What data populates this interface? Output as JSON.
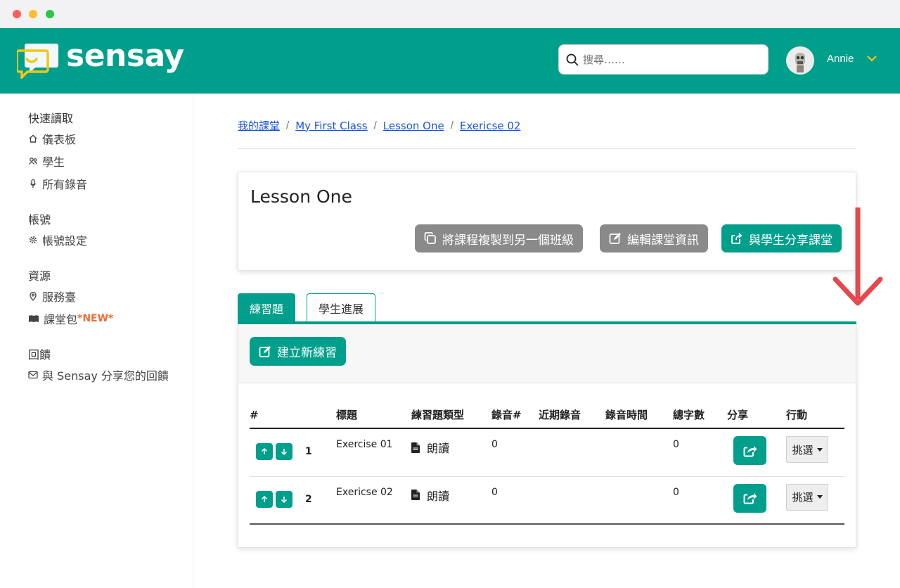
{
  "brand": {
    "name": "sensay"
  },
  "search": {
    "placeholder": "搜尋……"
  },
  "user": {
    "name": "Annie"
  },
  "sidebar": {
    "groups": [
      {
        "heading": "快速讀取",
        "items": [
          {
            "label": "儀表板",
            "icon": "home-icon"
          },
          {
            "label": "學生",
            "icon": "users-icon"
          },
          {
            "label": "所有錄音",
            "icon": "mic-icon"
          }
        ]
      },
      {
        "heading": "帳號",
        "items": [
          {
            "label": "帳號設定",
            "icon": "gear-icon"
          }
        ]
      },
      {
        "heading": "資源",
        "items": [
          {
            "label": "服務臺",
            "icon": "location-pin-icon"
          },
          {
            "label": "課堂包",
            "badge": "*NEW*",
            "icon": "book-icon"
          }
        ]
      },
      {
        "heading": "回饋",
        "items": [
          {
            "label": "與 Sensay 分享您的回饋",
            "icon": "envelope-icon"
          }
        ]
      }
    ]
  },
  "breadcrumb": [
    "我的課堂",
    "My First Class",
    "Lesson One",
    "Exericse 02"
  ],
  "lesson": {
    "title": "Lesson One",
    "copy_button": "將課程複製到另一個班級",
    "edit_button": "編輯課堂資訊",
    "share_button": "與學生分享課堂"
  },
  "tabs": [
    "練習題",
    "學生進展"
  ],
  "exercises": {
    "new_button": "建立新練習",
    "columns": [
      "#",
      "標題",
      "練習題類型",
      "錄音#",
      "近期錄音",
      "錄音時間",
      "總字數",
      "分享",
      "行動"
    ],
    "rows": [
      {
        "num": "1",
        "title": "Exercise 01",
        "type": "朗讀",
        "recordings": "0",
        "recent": "",
        "time": "",
        "words": "0",
        "action": "挑選"
      },
      {
        "num": "2",
        "title": "Exericse 02",
        "type": "朗讀",
        "recordings": "0",
        "recent": "",
        "time": "",
        "words": "0",
        "action": "挑選"
      }
    ]
  },
  "colors": {
    "brand": "#009f8c",
    "gray_button": "#8a8a8a",
    "annotation_arrow": "#e5484d",
    "new_badge": "#e8703a"
  }
}
